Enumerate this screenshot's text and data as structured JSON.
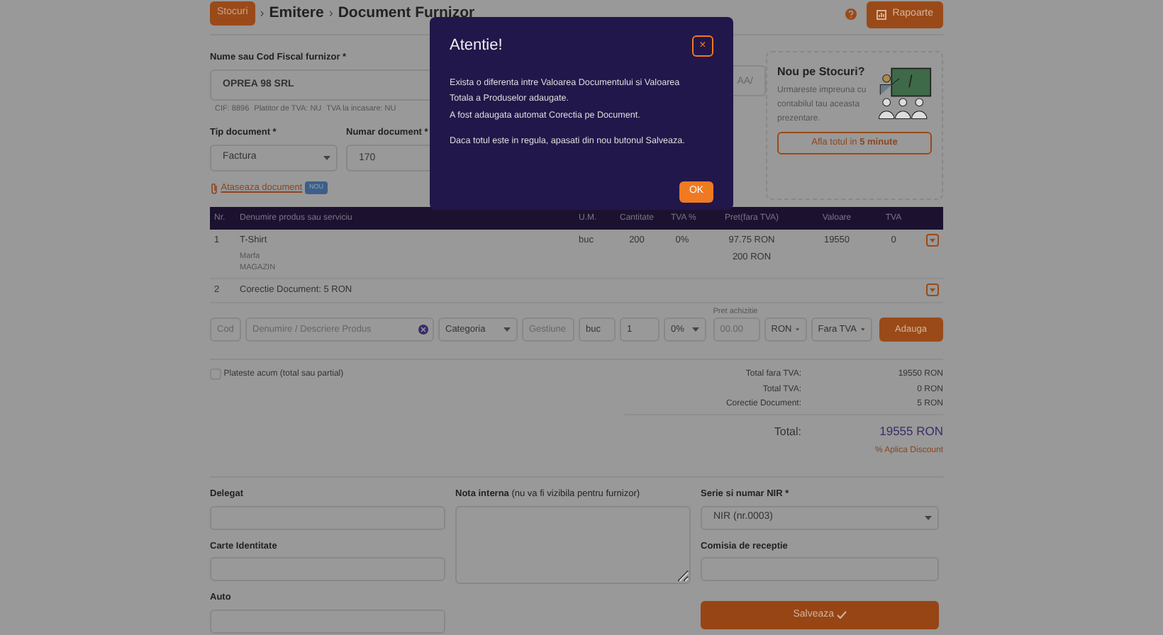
{
  "breadcrumb": [
    {
      "label": "Stocuri",
      "kind": "badge"
    },
    {
      "label": "Emitere",
      "kind": "text"
    },
    {
      "label": "Document Furnizor",
      "kind": "text"
    }
  ],
  "separator": "›",
  "reports_button": "Rapoarte",
  "supplier": {
    "label": "Nume sau Cod Fiscal furnizor *",
    "value": "OPREA 98 SRL",
    "details": [
      "CIF: 8896",
      "Platitor de TVA: NU",
      "TVA la incasare: NU"
    ]
  },
  "doc_type": {
    "label": "Tip document *",
    "value": "Factura"
  },
  "doc_number": {
    "label": "Numar document *",
    "value": "170"
  },
  "date_field": {
    "placeholder": "AA/"
  },
  "attach": {
    "label": "Ataseaza document",
    "badge": "NOU"
  },
  "promo": {
    "title": "Nou pe Stocuri?",
    "text": "Urmareste impreuna cu contabilul tau aceasta prezentare.",
    "button": "Afla totul in **5 minute**"
  },
  "table": {
    "columns": [
      "Nr.",
      "Denumire produs sau serviciu",
      "U.M.",
      "Cantitate",
      "TVA %",
      "Pret(fara TVA)",
      "Valoare",
      "TVA"
    ],
    "rows": [
      {
        "nr": "1",
        "name": "T-Shirt",
        "details": [
          "Marfa",
          "MAGAZIN"
        ],
        "unit": "buc",
        "quantity": "200",
        "vat_rate": "0%",
        "price": [
          "97.75 RON",
          "200 RON"
        ],
        "value": "19550",
        "vat": "0"
      },
      {
        "nr": "2",
        "name": "Corectie Document: 5 RON"
      }
    ]
  },
  "new_item": {
    "code": {
      "placeholder": "Cod"
    },
    "name": {
      "placeholder": "Denumire / Descriere Produs"
    },
    "category": "Categoria",
    "warehouse": {
      "placeholder": "Gestiune"
    },
    "unit": "buc",
    "quantity": "1",
    "vat": "0%",
    "price": {
      "label": "Pret achizitie",
      "placeholder": "00.00"
    },
    "currency": "RON",
    "vat_mode": "Fara TVA",
    "button": "Adauga"
  },
  "pay_now": {
    "label": "Plateste acum (total sau partial)",
    "checked": false
  },
  "totals": [
    {
      "label": "Total fara TVA:",
      "value": "19550 RON"
    },
    {
      "label": "Total TVA:",
      "value": "0 RON"
    },
    {
      "label": "Corectie Document:",
      "value": "5 RON"
    }
  ],
  "total": {
    "label": "Total:",
    "value": "19555 RON"
  },
  "discount_link": "% Aplica Discount",
  "delegate": {
    "label": "Delegat"
  },
  "id_card": {
    "label": "Carte Identitate"
  },
  "car": {
    "label": "Auto"
  },
  "note": {
    "label": "**Nota interna** (nu va fi vizibila pentru furnizor)"
  },
  "nir": {
    "label": "Serie si numar NIR *",
    "value": "NIR (nr.0003)"
  },
  "commission": {
    "label": "Comisia de receptie"
  },
  "save_button": "Salveaza",
  "modal": {
    "title": "Atentie!",
    "close": "×",
    "paragraphs": [
      "Exista o diferenta intre Valoarea Documentului si Valoarea Totala a Produselor adaugate.",
      "A fost adaugata automat Corectia pe Document.",
      "Daca totul este in regula, apasati din nou butonul Salveaza."
    ],
    "button": "OK"
  }
}
